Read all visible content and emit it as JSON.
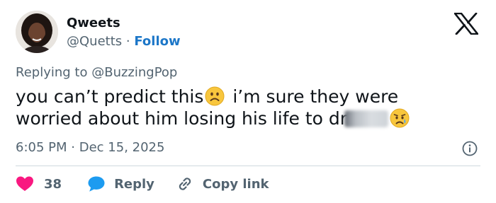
{
  "author": {
    "display_name": "Qweets",
    "handle": "@Quetts",
    "separator": "·",
    "follow_label": "Follow"
  },
  "reply": {
    "prefix": "Replying to",
    "mention": "@BuzzingPop"
  },
  "tweet": {
    "line1_before_emoji": "you can’t predict this",
    "line1_after_emoji": " i’m sure they were",
    "line2_text": "worried about him losing his life to dr"
  },
  "meta": {
    "time": "6:05 PM",
    "separator": "·",
    "date": "Dec 15, 2025"
  },
  "actions": {
    "likes": "38",
    "reply_label": "Reply",
    "copy_label": "Copy link"
  },
  "icons": {
    "logo": "x-logo-icon",
    "emoji1": "slightly-frowning-face-icon",
    "emoji2": "sad-but-relieved-face-icon",
    "info": "info-icon",
    "like": "heart-icon",
    "reply": "speech-bubble-icon",
    "copy": "link-icon"
  },
  "colors": {
    "heart": "#f91880",
    "reply_bubble": "#1d9bf0",
    "follow": "#1d77c8",
    "secondary_text": "#536471"
  }
}
